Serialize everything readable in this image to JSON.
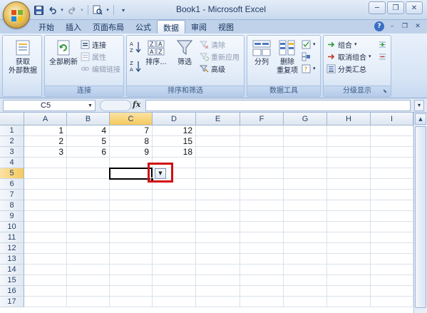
{
  "window": {
    "title": "Book1 - Microsoft Excel",
    "minimize": "─",
    "restore": "❐",
    "close": "✕"
  },
  "qat": {
    "save": "💾",
    "undo": "↶",
    "redo": "↷",
    "print_preview": "🖨",
    "customize": "▾"
  },
  "tabs": [
    {
      "label": "开始",
      "active": false
    },
    {
      "label": "插入",
      "active": false
    },
    {
      "label": "页面布局",
      "active": false
    },
    {
      "label": "公式",
      "active": false
    },
    {
      "label": "数据",
      "active": true
    },
    {
      "label": "审阅",
      "active": false
    },
    {
      "label": "视图",
      "active": false
    }
  ],
  "tab_right": {
    "help": "?",
    "min": "–",
    "restore": "❐",
    "close": "✕"
  },
  "ribbon": {
    "get_external": {
      "label": "获取\n外部数据",
      "line1": "获取",
      "line2": "外部数据"
    },
    "connections": {
      "group_label": "连接",
      "refresh_all": "全部刷新",
      "connections": "连接",
      "properties": "属性",
      "edit_links": "编辑链接"
    },
    "sort_filter": {
      "group_label": "排序和筛选",
      "sort": "排序...",
      "filter": "筛选",
      "clear": "清除",
      "reapply": "重新应用",
      "advanced": "高级"
    },
    "data_tools": {
      "group_label": "数据工具",
      "text_to_columns": "分列",
      "remove_dup_line1": "删除",
      "remove_dup_line2": "重复项"
    },
    "outline": {
      "group_label": "分级显示",
      "group": "组合",
      "ungroup": "取消组合",
      "subtotal": "分类汇总"
    }
  },
  "formula_bar": {
    "name_box": "C5",
    "fx": "fx",
    "formula": ""
  },
  "grid": {
    "columns": [
      "A",
      "B",
      "C",
      "D",
      "E",
      "F",
      "G",
      "H",
      "I"
    ],
    "selected_column": "C",
    "rows": [
      "1",
      "2",
      "3",
      "4",
      "5",
      "6",
      "7",
      "8",
      "9",
      "10",
      "11",
      "12",
      "13",
      "14",
      "15",
      "16",
      "17"
    ],
    "selected_row": "5",
    "cells": {
      "A1": "1",
      "B1": "4",
      "C1": "7",
      "D1": "12",
      "A2": "2",
      "B2": "5",
      "C2": "8",
      "D2": "15",
      "A3": "3",
      "B3": "6",
      "C3": "9",
      "D3": "18"
    },
    "active_cell": "C5"
  }
}
